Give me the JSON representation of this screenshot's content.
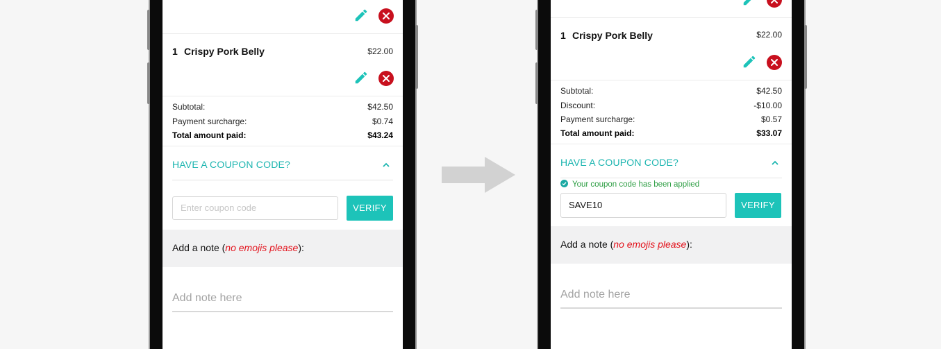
{
  "before": {
    "order_item": {
      "qty": "1",
      "name": "Crispy Pork Belly",
      "price": "$22.00"
    },
    "summary": [
      {
        "label": "Subtotal:",
        "value": "$42.50"
      },
      {
        "label": "Payment surcharge:",
        "value": "$0.74"
      },
      {
        "label": "Total amount paid:",
        "value": "$43.24"
      }
    ],
    "coupon": {
      "heading": "HAVE A COUPON CODE?",
      "placeholder": "Enter coupon code",
      "button": "VERIFY"
    },
    "note": {
      "prefix": "Add a note (",
      "emphasis": "no emojis please",
      "suffix": "):",
      "placeholder": "Add note here"
    }
  },
  "after": {
    "order_item": {
      "qty": "1",
      "name": "Crispy Pork Belly",
      "price": "$22.00"
    },
    "summary": [
      {
        "label": "Subtotal:",
        "value": "$42.50"
      },
      {
        "label": "Discount:",
        "value": "-$10.00"
      },
      {
        "label": "Payment surcharge:",
        "value": "$0.57"
      },
      {
        "label": "Total amount paid:",
        "value": "$33.07"
      }
    ],
    "coupon": {
      "heading": "HAVE A COUPON CODE?",
      "applied_message": "Your coupon code has been applied",
      "value": "SAVE10",
      "button": "VERIFY"
    },
    "note": {
      "prefix": "Add a note (",
      "emphasis": "no emojis please",
      "suffix": "):",
      "placeholder": "Add note here"
    }
  },
  "colors": {
    "accent": "#1dc3b9",
    "remove": "#c8101e",
    "success": "#2e9e44",
    "warning": "#e3111b"
  },
  "icons": [
    "pencil-icon",
    "remove-icon",
    "chevron-up-icon",
    "check-circle-icon",
    "arrow-right-icon"
  ]
}
